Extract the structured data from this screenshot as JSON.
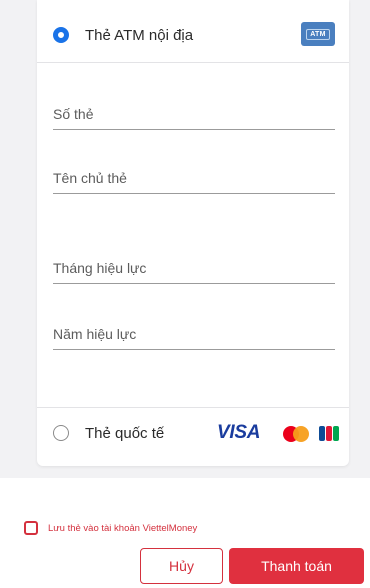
{
  "payment_methods": {
    "atm": {
      "label": "Thẻ ATM nội địa",
      "icon": "atm-card-icon",
      "icon_text": "ATM",
      "selected": true
    },
    "international": {
      "label": "Thẻ quốc tế",
      "selected": false,
      "brands": {
        "visa": "VISA",
        "mastercard": "mastercard-logo",
        "jcb": "jcb-logo"
      }
    }
  },
  "form": {
    "card_number_label": "Số thẻ",
    "card_holder_label": "Tên chủ thẻ",
    "valid_month_label": "Tháng hiệu lực",
    "valid_year_label": "Năm hiệu lực"
  },
  "save_card": {
    "label": "Lưu thẻ vào tài khoản ViettelMoney",
    "checked": false
  },
  "actions": {
    "cancel_label": "Hủy",
    "pay_label": "Thanh toán"
  },
  "colors": {
    "accent": "#e0303f",
    "radio_selected": "#1a73e8",
    "visa": "#1a3c9e"
  }
}
